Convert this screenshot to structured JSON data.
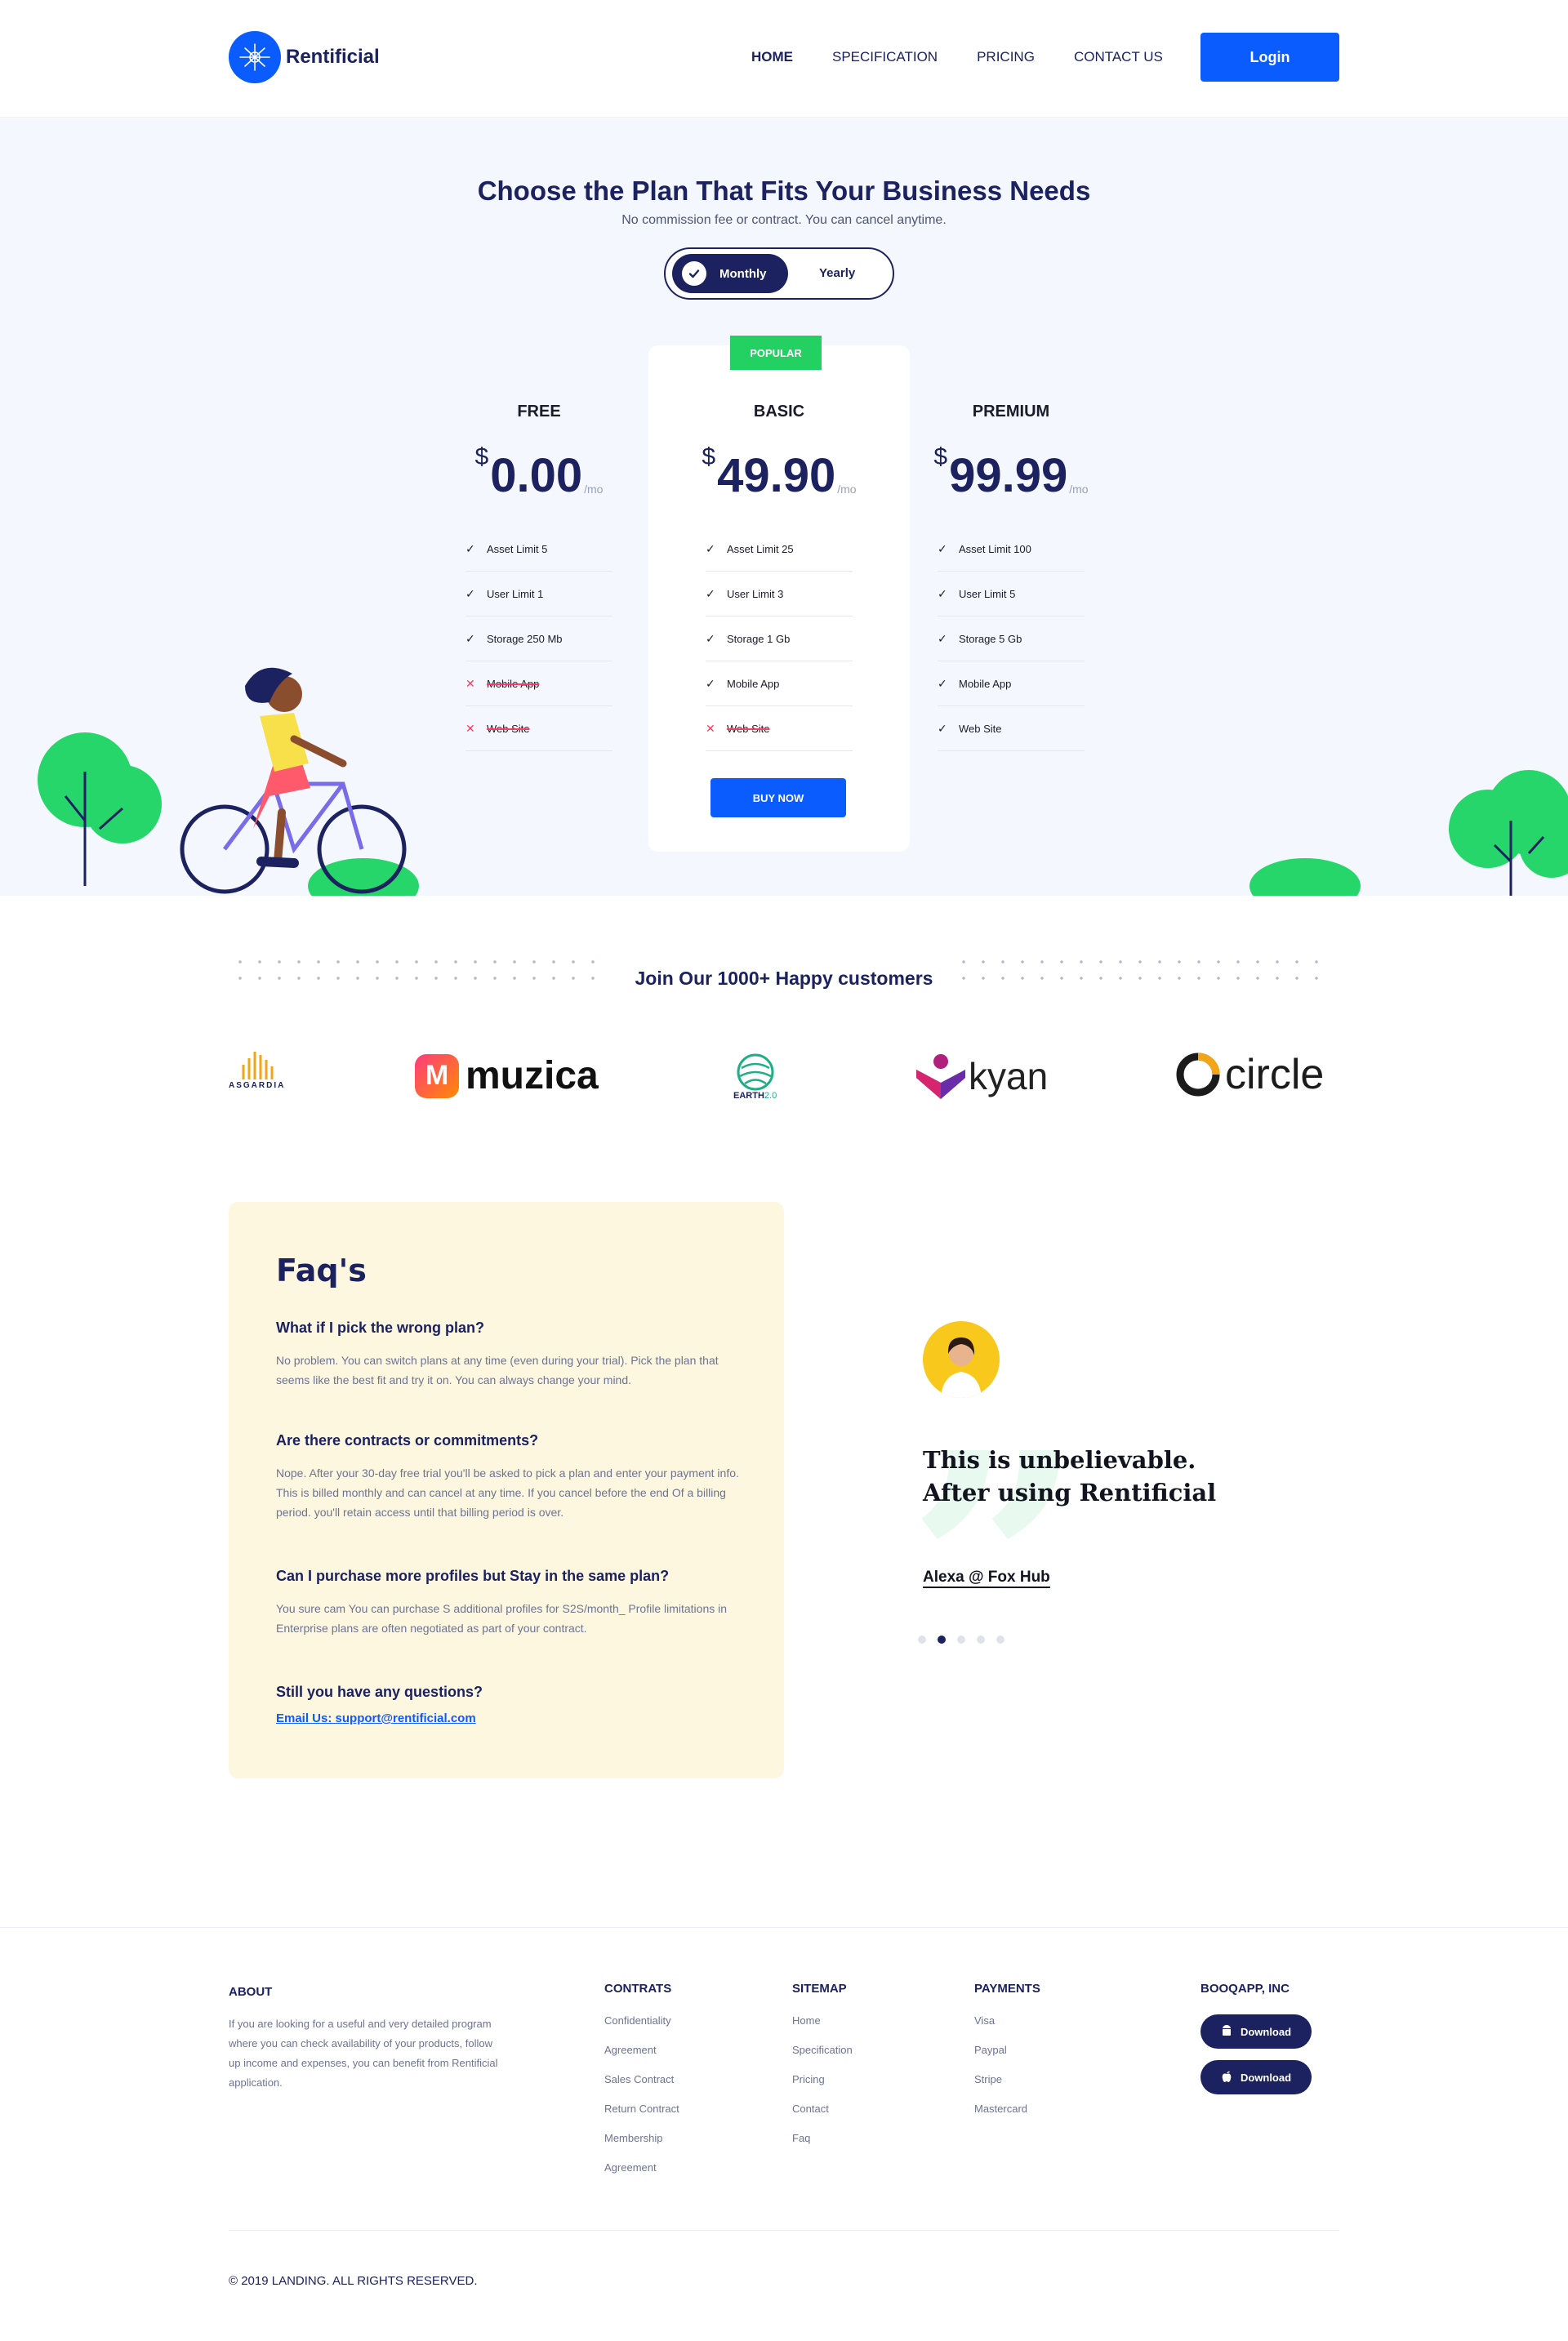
{
  "brand": {
    "name": "Rentificial",
    "accent": "#0b5cff",
    "navy": "#1c2260",
    "green": "#23d162"
  },
  "nav": {
    "links": [
      "HOME",
      "SPECIFICATION",
      "PRICING",
      "CONTACT US"
    ],
    "login_label": "Login"
  },
  "pricing": {
    "title": "Choose the Plan That Fits Your Business Needs",
    "subtitle": "No commission fee or contract. You can cancel anytime.",
    "toggle": {
      "monthly": "Monthly",
      "yearly": "Yearly",
      "selected": "Monthly"
    },
    "plans": [
      {
        "name": "FREE",
        "currency": "$",
        "price": "0.00",
        "period": "/mo",
        "features": [
          {
            "label": "Asset Limit 5",
            "included": true
          },
          {
            "label": "User Limit 1",
            "included": true
          },
          {
            "label": "Storage 250 Mb",
            "included": true
          },
          {
            "label": "Mobile App",
            "included": false
          },
          {
            "label": "Web Site",
            "included": false
          }
        ]
      },
      {
        "name": "BASIC",
        "currency": "$",
        "price": "49.90",
        "period": "/mo",
        "badge": "POPULAR",
        "cta": "BUY NOW",
        "features": [
          {
            "label": "Asset Limit 25",
            "included": true
          },
          {
            "label": "User Limit 3",
            "included": true
          },
          {
            "label": "Storage 1 Gb",
            "included": true
          },
          {
            "label": "Mobile App",
            "included": true
          },
          {
            "label": "Web Site",
            "included": false
          }
        ]
      },
      {
        "name": "PREMIUM",
        "currency": "$",
        "price": "99.99",
        "period": "/mo",
        "features": [
          {
            "label": "Asset Limit 100",
            "included": true
          },
          {
            "label": "User Limit 5",
            "included": true
          },
          {
            "label": "Storage 5 Gb",
            "included": true
          },
          {
            "label": "Mobile App",
            "included": true
          },
          {
            "label": "Web Site",
            "included": true
          }
        ]
      }
    ]
  },
  "customers": {
    "title": "Join Our 1000+ Happy customers",
    "logos": {
      "asgardia": "ASGARDIA",
      "muzica": "muzica",
      "earth": "EARTH",
      "earth_version": "2.0",
      "kyan": "kyan",
      "circle": "circle"
    }
  },
  "faq": {
    "title": "Faq's",
    "items": [
      {
        "q": "What if I pick the wrong plan?",
        "a": "No problem. You can switch plans at any time (even during your trial). Pick the plan that seems like the best fit and try it on. You can always change your mind."
      },
      {
        "q": "Are there contracts or commitments?",
        "a": "Nope. After your 30-day free trial you'll be asked to pick a plan and enter your payment info. This is billed monthly and can cancel at any time. If you cancel before the end Of a billing period. you'll retain access until that billing period is over."
      },
      {
        "q": "Can I purchase more profiles but Stay in the same plan?",
        "a": "You sure cam You can purchase S additional profiles for S2S/month_ Profile limitations in Enterprise plans are often negotiated as part of your contract."
      }
    ],
    "contact_q": "Still you have any questions?",
    "contact_email": "Email Us: support@rentificial.com"
  },
  "testimonial": {
    "quote_line1": "This is unbelievable.",
    "quote_line2": "After using Rentificial",
    "author": "Alexa @ Fox Hub",
    "slides": 5,
    "active_slide": 2
  },
  "footer": {
    "about_head": "ABOUT",
    "about_text": "If you are looking for a useful and very detailed program where you can check availability of your products, follow up income and expenses, you can benefit from Rentificial application.",
    "contracts_head": "CONTRATS",
    "contracts": [
      "Confidentiality",
      "Agreement",
      "Sales Contract",
      "Return Contract",
      "Membership",
      "Agreement"
    ],
    "sitemap_head": "SITEMAP",
    "sitemap": [
      "Home",
      "Specification",
      "Pricing",
      "Contact",
      "Faq"
    ],
    "payments_head": "PAYMENTS",
    "payments": [
      "Visa",
      "Paypal",
      "Stripe",
      "Mastercard"
    ],
    "company_head": "BOOQAPP, INC",
    "android_label": "Download",
    "ios_label": "Download",
    "copyright": "© 2019 LANDING. ALL RIGHTS RESERVED."
  }
}
